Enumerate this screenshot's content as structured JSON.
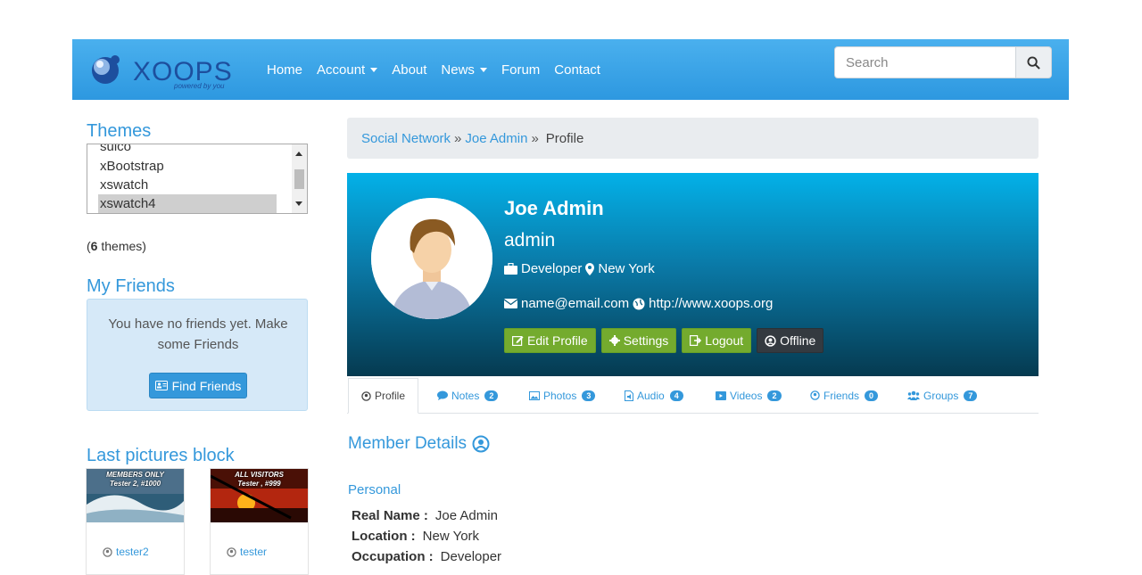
{
  "navbar": {
    "brand": "XOOPS",
    "brand_tagline": "powered by you",
    "items": [
      {
        "label": "Home",
        "dropdown": false
      },
      {
        "label": "Account",
        "dropdown": true
      },
      {
        "label": "About",
        "dropdown": false
      },
      {
        "label": "News",
        "dropdown": true
      },
      {
        "label": "Forum",
        "dropdown": false
      },
      {
        "label": "Contact",
        "dropdown": false
      }
    ],
    "search_placeholder": "Search",
    "search_icon": "search-icon"
  },
  "sidebar": {
    "themes_title": "Themes",
    "themes": [
      "suico",
      "xBootstrap",
      "xswatch",
      "xswatch4"
    ],
    "selected_theme": "xswatch4",
    "count_open": "(",
    "count_number": "6",
    "count_suffix": " themes)",
    "friends_title": "My Friends",
    "friends_message": "You have no friends yet. Make some Friends",
    "find_friends_label": "Find Friends",
    "pictures_title": "Last pictures block",
    "pictures": [
      {
        "caption1": "MEMBERS ONLY",
        "caption2": "Tester 2, #1000",
        "user": "tester2"
      },
      {
        "caption1": "ALL VISITORS",
        "caption2": "Tester , #999",
        "user": "tester"
      }
    ]
  },
  "breadcrumb": {
    "items": [
      "Social Network",
      "Joe Admin"
    ],
    "separator": "»",
    "current": "Profile"
  },
  "profile": {
    "name": "Joe Admin",
    "username": "admin",
    "occupation": "Developer",
    "location": "New York",
    "email": "name@email.com",
    "website": "http://www.xoops.org",
    "buttons": {
      "edit": "Edit Profile",
      "settings": "Settings",
      "logout": "Logout",
      "status": "Offline"
    }
  },
  "tabs": [
    {
      "label": "Profile",
      "icon": "user-circle-icon",
      "badge": null
    },
    {
      "label": "Notes",
      "icon": "comment-icon",
      "badge": "2"
    },
    {
      "label": "Photos",
      "icon": "image-icon",
      "badge": "3"
    },
    {
      "label": "Audio",
      "icon": "audio-file-icon",
      "badge": "4"
    },
    {
      "label": "Videos",
      "icon": "video-icon",
      "badge": "2"
    },
    {
      "label": "Friends",
      "icon": "user-circle-icon",
      "badge": "0"
    },
    {
      "label": "Groups",
      "icon": "users-icon",
      "badge": "7"
    }
  ],
  "member_details": {
    "title": "Member Details",
    "section": "Personal",
    "fields": [
      {
        "label": "Real Name :",
        "value": "Joe Admin"
      },
      {
        "label": "Location :",
        "value": "New York"
      },
      {
        "label": "Occupation :",
        "value": "Developer"
      }
    ]
  },
  "colors": {
    "navbar": "#2d98e0",
    "accent": "#3498db",
    "button_green": "#74ab2e",
    "button_dark": "#343a40"
  }
}
